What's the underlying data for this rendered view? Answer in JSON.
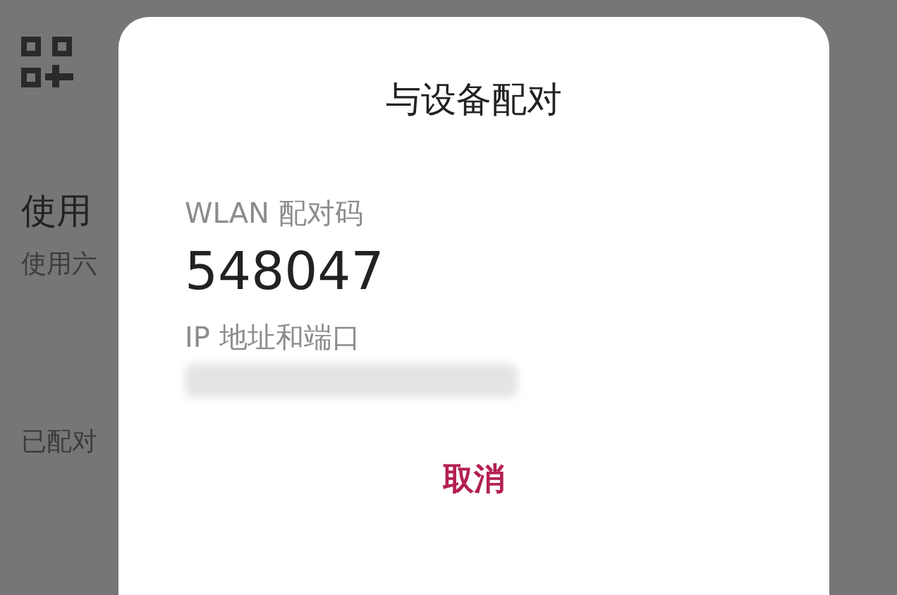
{
  "background": {
    "heading": "使用",
    "subtitle": "使用六",
    "section": "已配对"
  },
  "dialog": {
    "title": "与设备配对",
    "code_label": "WLAN 配对码",
    "code": "548047",
    "address_label": "IP 地址和端口",
    "buttons": [
      "取消"
    ]
  }
}
